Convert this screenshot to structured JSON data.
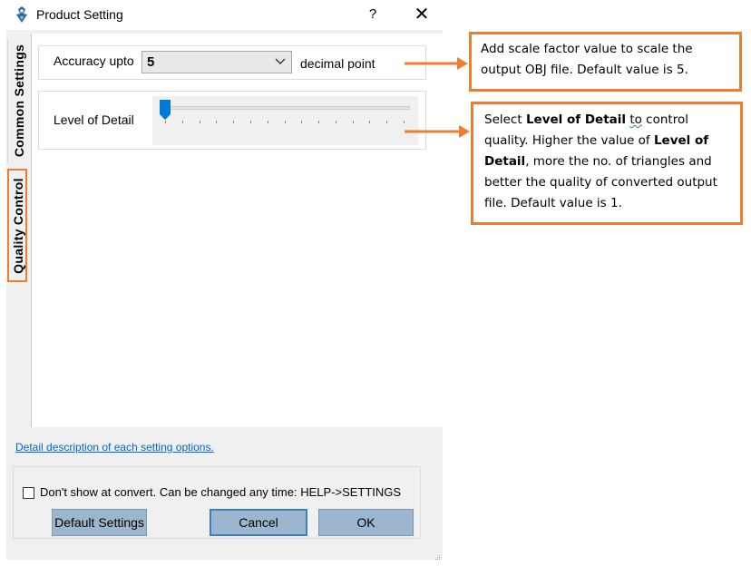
{
  "window": {
    "title": "Product Setting",
    "help_label": "?",
    "close_label": "✕",
    "app_icon": "app-logo-icon"
  },
  "tabs": [
    {
      "label": "Common Settings",
      "selected": false
    },
    {
      "label": "Quality Control",
      "selected": true
    }
  ],
  "accuracy": {
    "label": "Accuracy upto",
    "value": "5",
    "suffix": "decimal point"
  },
  "level_of_detail": {
    "label": "Level of Detail",
    "value": 1,
    "tick_count": 15
  },
  "footer": {
    "link_text": "Detail description of each setting options.",
    "checkbox_label": "Don't show at convert. Can be changed any time: HELP->SETTINGS",
    "checkbox_checked": false,
    "buttons": {
      "default": "Default Settings",
      "cancel": "Cancel",
      "ok": "OK"
    }
  },
  "callouts": {
    "accuracy_line1": "Add scale factor value to scale the",
    "accuracy_line2": "output OBJ file. Default value is 5.",
    "lod_pre": "Select ",
    "lod_bold1": "Level of Detail",
    "lod_mid1": " ",
    "lod_to": "to",
    "lod_mid2": "  control quality. Higher the value of ",
    "lod_bold2": "Level of Detail",
    "lod_post": ", more the no. of triangles and better the quality of converted output file. Default value is 1."
  },
  "colors": {
    "accent_orange": "#ed7d31",
    "button_blue": "#9cb6cf",
    "link_blue": "#0066cc",
    "slider_thumb": "#0078d7"
  }
}
